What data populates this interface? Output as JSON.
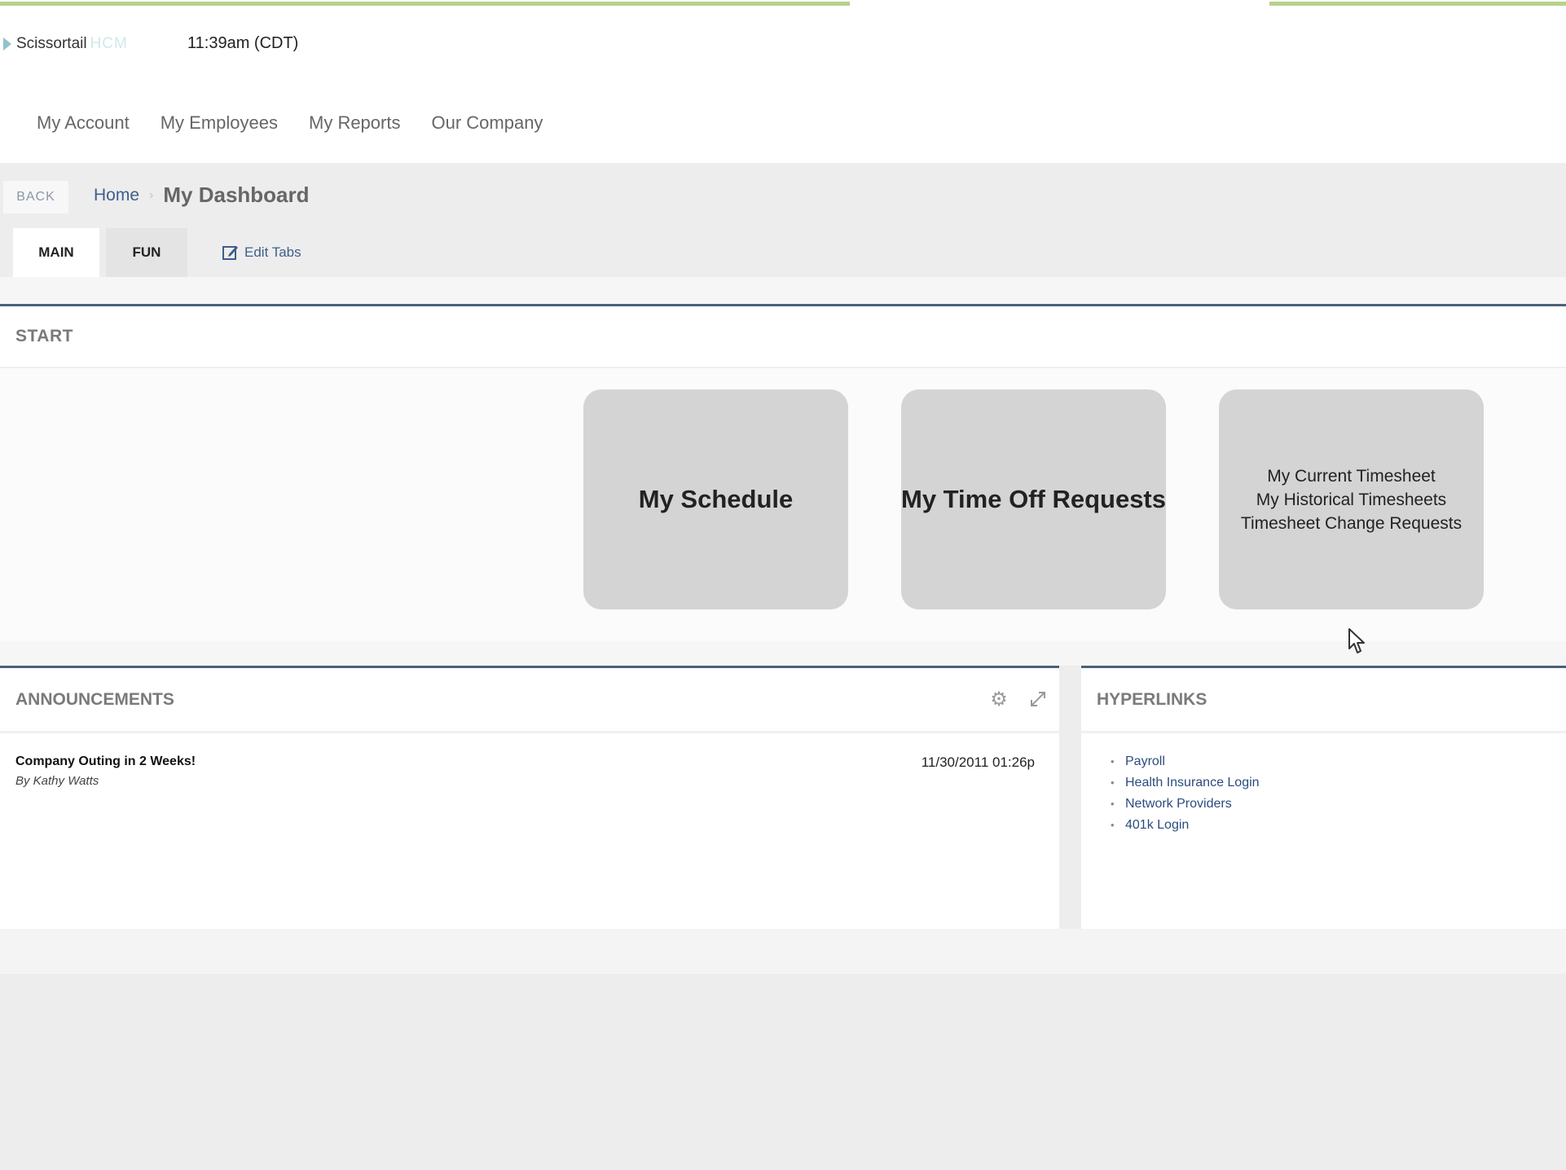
{
  "app": {
    "logo_name": "Scissortail",
    "logo_suffix": "HCM",
    "clock": "11:39am (CDT)"
  },
  "top_nav": [
    {
      "label": "My Account"
    },
    {
      "label": "My Employees"
    },
    {
      "label": "My Reports"
    },
    {
      "label": "Our Company"
    }
  ],
  "breadcrumb": {
    "back_label": "BACK",
    "home": "Home",
    "separator": "›",
    "current": "My Dashboard"
  },
  "tabs": {
    "main": "MAIN",
    "fun": "FUN",
    "edit": "Edit Tabs"
  },
  "start_panel": {
    "title": "START",
    "tiles": [
      {
        "label": "My Schedule"
      },
      {
        "label": "My Time Off Requests"
      },
      {
        "lines": [
          "My Current Timesheet",
          "My Historical Timesheets",
          "Timesheet Change Requests"
        ]
      }
    ]
  },
  "announcements": {
    "title": "ANNOUNCEMENTS",
    "icons": [
      "gear-icon",
      "expand-icon"
    ],
    "items": [
      {
        "title": "Company Outing in 2 Weeks!",
        "author": "By Kathy Watts",
        "date": "11/30/2011 01:26p"
      }
    ]
  },
  "hyperlinks": {
    "title": "HYPERLINKS",
    "items": [
      "Payroll",
      "Health Insurance Login",
      "Network Providers",
      "401k Login"
    ]
  },
  "colors": {
    "accent_green": "#b6d28a",
    "panel_border": "#4a6278",
    "link_blue": "#2b4c7e",
    "tile_bg": "#d4d4d4"
  }
}
